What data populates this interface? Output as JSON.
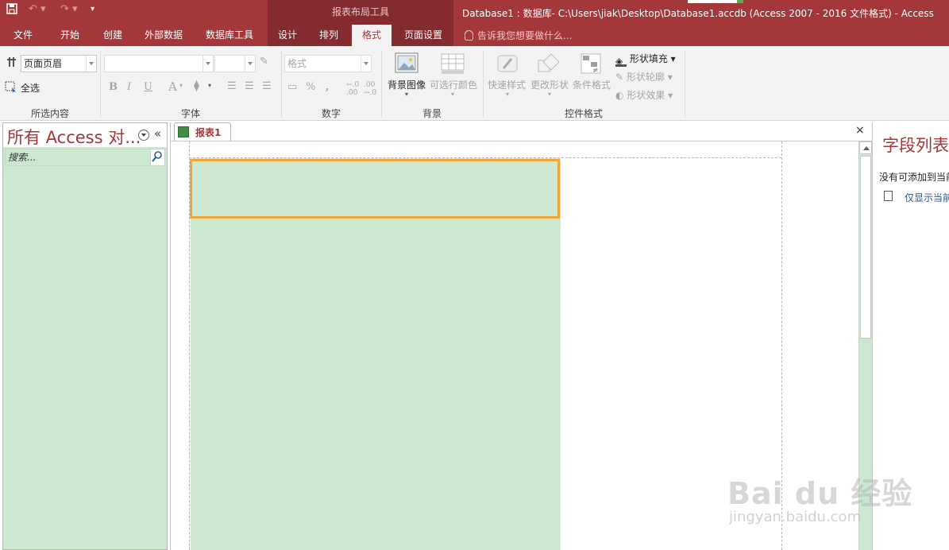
{
  "window": {
    "title": "Database1 : 数据库- C:\\Users\\jiak\\Desktop\\Database1.accdb (Access 2007 - 2016 文件格式) - Access",
    "context_group": "报表布局工具"
  },
  "qat": {
    "save": "save-icon",
    "undo": "undo-icon",
    "redo": "redo-icon",
    "more": "customize-icon"
  },
  "tabs": [
    "文件",
    "开始",
    "创建",
    "外部数据",
    "数据库工具",
    "设计",
    "排列",
    "格式",
    "页面设置"
  ],
  "active_tab": "格式",
  "tell_me": "告诉我您想要做什么...",
  "ribbon": {
    "selection": {
      "combo_value": "页面页眉",
      "select_all": "全选",
      "group": "所选内容"
    },
    "font": {
      "font_combo": "",
      "size_combo": "",
      "bold": "B",
      "italic": "I",
      "underline": "U",
      "font_color": "A",
      "group": "字体"
    },
    "number": {
      "format_combo": "格式",
      "percent": "%",
      "comma": ",",
      "group": "数字"
    },
    "background": {
      "bg_image": "背景图像",
      "alt_row": "可选行颜色",
      "group": "背景"
    },
    "control_format": {
      "quick_styles": "快速样式",
      "change_shape": "更改形状",
      "conditional": "条件格式",
      "shape_fill": "形状填充",
      "shape_outline": "形状轮廓",
      "shape_effects": "形状效果",
      "group": "控件格式"
    }
  },
  "nav": {
    "title": "所有 Access 对...",
    "search_placeholder": "搜索..."
  },
  "document": {
    "tab_label": "报表1",
    "close": "×"
  },
  "field_list": {
    "title": "字段列表",
    "message": "没有可添加到当前",
    "link": "仅显示当前"
  },
  "watermark": {
    "main": "Bai du 经验",
    "sub": "jingyan.baidu.com"
  }
}
